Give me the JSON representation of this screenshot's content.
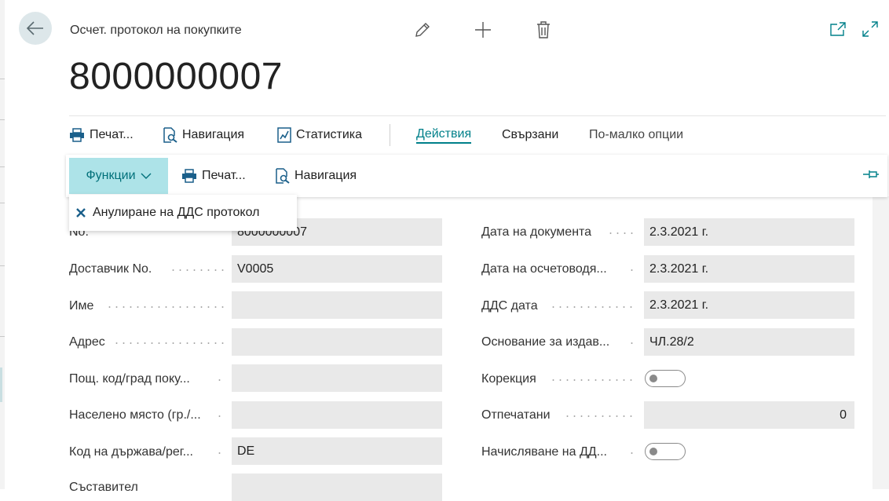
{
  "header": {
    "caption": "Осчет. протокол на покупките",
    "record_no": "8000000007"
  },
  "icons": {
    "back": "arrow-left-icon",
    "edit": "pencil-icon",
    "new": "plus-icon",
    "delete": "trash-icon",
    "open_new_window": "open-in-new-window-icon",
    "expand": "expand-icon"
  },
  "action_bar": {
    "print_label": "Печат...",
    "navigate_label": "Навигация",
    "statistics_label": "Статистика",
    "actions_label": "Действия",
    "related_label": "Свързани",
    "fewer_options_label": "По-малко опции"
  },
  "sub_bar": {
    "functions_label": "Функции",
    "print_label": "Печат...",
    "navigate_label": "Навигация"
  },
  "dropdown": {
    "item_label": "Анулиране на ДДС протокол"
  },
  "left_fields": [
    {
      "label": "No.",
      "value": "8000000007"
    },
    {
      "label": "Доставчик No.",
      "value": "V0005"
    },
    {
      "label": "Име",
      "value": ""
    },
    {
      "label": "Адрес",
      "value": ""
    },
    {
      "label": "Пощ. код/град поку...",
      "value": ""
    },
    {
      "label": "Населено място (гр./...",
      "value": ""
    },
    {
      "label": "Код на държава/рег...",
      "value": "DE"
    },
    {
      "label": "Съставител",
      "value": ""
    }
  ],
  "right_fields": [
    {
      "label": "Дата на документа",
      "value": "2.3.2021 г."
    },
    {
      "label": "Дата на осчетоводя...",
      "value": "2.3.2021 г."
    },
    {
      "label": "ДДС дата",
      "value": "2.3.2021 г."
    },
    {
      "label": "Основание за издав...",
      "value": "ЧЛ.28/2"
    },
    {
      "label": "Корекция",
      "toggle": false
    },
    {
      "label": "Отпечатани",
      "value": "0"
    },
    {
      "label": "Начисляване на ДД...",
      "toggle": false
    }
  ],
  "colors": {
    "accent": "#00808a",
    "functions_bg": "#ade3e8",
    "field_bg": "#e9e9e9",
    "back_bg": "#dde7ea"
  }
}
